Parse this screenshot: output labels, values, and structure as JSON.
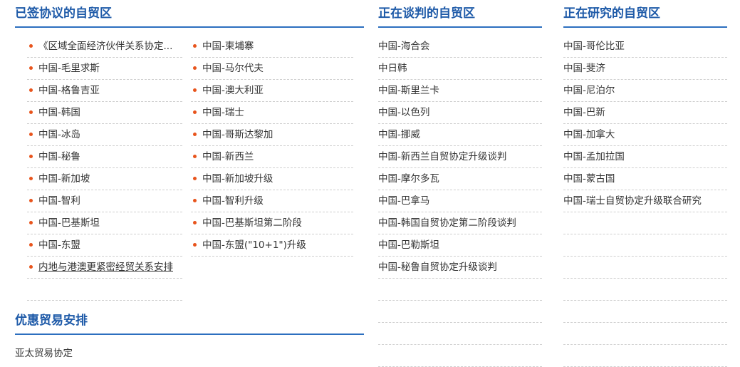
{
  "signed": {
    "title": "已签协议的自贸区",
    "left_items": [
      "《区域全面经济伙伴关系协定...",
      "中国-毛里求斯",
      "中国-格鲁吉亚",
      "中国-韩国",
      "中国-冰岛",
      "中国-秘鲁",
      "中国-新加坡",
      "中国-智利",
      "中国-巴基斯坦",
      "中国-东盟",
      "内地与港澳更紧密经贸关系安排"
    ],
    "right_items": [
      "中国-柬埔寨",
      "中国-马尔代夫",
      "中国-澳大利亚",
      "中国-瑞士",
      "中国-哥斯达黎加",
      "中国-新西兰",
      "中国-新加坡升级",
      "中国-智利升级",
      "中国-巴基斯坦第二阶段",
      "中国-东盟(\"10+1\")升级"
    ]
  },
  "negotiating": {
    "title": "正在谈判的自贸区",
    "items": [
      "中国-海合会",
      "中日韩",
      "中国-斯里兰卡",
      "中国-以色列",
      "中国-挪威",
      "中国-新西兰自贸协定升级谈判",
      "中国-摩尔多瓦",
      "中国-巴拿马",
      "中国-韩国自贸协定第二阶段谈判",
      "中国-巴勒斯坦",
      "中国-秘鲁自贸协定升级谈判"
    ]
  },
  "researching": {
    "title": "正在研究的自贸区",
    "items": [
      "中国-哥伦比亚",
      "中国-斐济",
      "中国-尼泊尔",
      "中国-巴新",
      "中国-加拿大",
      "中国-孟加拉国",
      "中国-蒙古国",
      "中国-瑞士自贸协定升级联合研究"
    ]
  },
  "preferential": {
    "title": "优惠贸易安排",
    "items": [
      "亚太贸易协定"
    ]
  },
  "colors": {
    "title": "#1e5aa8",
    "underline": "#2c6fbf",
    "bullet": "#e8541c"
  }
}
